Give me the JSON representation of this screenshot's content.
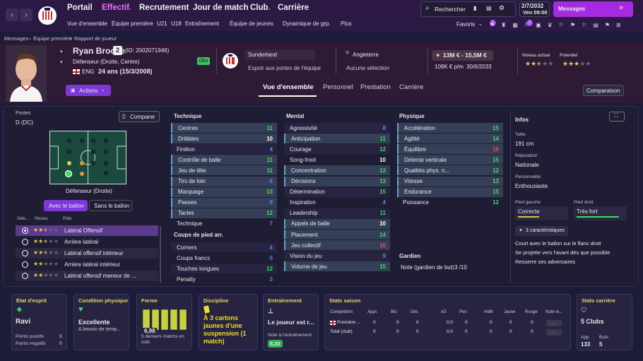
{
  "nav": {
    "items": [
      "Portail",
      "Effectif",
      "Recrutement",
      "Jour de match",
      "Club",
      "Carrière"
    ],
    "sub": [
      "Vue d'ensemble",
      "Équipe première",
      "U21",
      "U18",
      "Entraînement",
      "Équipe de jeunes",
      "Dynamique de grp.",
      "Plus"
    ],
    "search": "Rechercher",
    "date": "2/7/2032",
    "day": "Ven 09:00",
    "messages": "Messages",
    "favoris": "Favoris",
    "fav_badges": [
      "1",
      "2"
    ]
  },
  "breadcrumb": [
    "Messages",
    "Équipe première",
    "Rapport de joueur"
  ],
  "player": {
    "name": "Ryan Brooke",
    "number": "2",
    "id": "(ID: 2002071946)",
    "position": "Défenseur (Droite, Centre)",
    "nation": "ENG",
    "age": "24 ans (15/3/2008)",
    "tag": "Obs",
    "club": "Sunderland",
    "club_status": "Espoir aux portes de l'équipe",
    "national": "Angleterre",
    "national_status": "Aucune sélection",
    "value": "13M € - 15,5M €",
    "wage": "108K € p/m",
    "contract": "30/6/2033",
    "level_label": "Niveau actuel",
    "potential_label": "Potentiel",
    "level_stars": 2.5,
    "potential_stars": 3,
    "actions": "Actions"
  },
  "tabs": [
    "Vue d'ensemble",
    "Personnel",
    "Prestation",
    "Carrière"
  ],
  "compare_btn": "Comparaison",
  "positions": {
    "title": "Postes",
    "value": "D (DC)",
    "compare": "Comparer",
    "role_label": "Défenseur (Droite)",
    "with_ball": "Avec le ballon",
    "without_ball": "Sans le ballon",
    "cols": [
      "Séle...",
      "Niveau",
      "Rôle"
    ],
    "roles": [
      {
        "name": "Latéral Offensif",
        "stars": 2.5,
        "selected": true
      },
      {
        "name": "Arrière latéral",
        "stars": 2.5,
        "selected": false
      },
      {
        "name": "Latéral offensif intérieur",
        "stars": 2.5,
        "selected": false
      },
      {
        "name": "Arrière latéral intérieur",
        "stars": 2,
        "selected": false
      },
      {
        "name": "Latéral offensif meneur de ...",
        "stars": 2,
        "selected": false
      }
    ]
  },
  "technique": {
    "title": "Technique",
    "rows": [
      [
        "Centres",
        "11"
      ],
      [
        "Dribbles",
        "10"
      ],
      [
        "Finition",
        "4"
      ],
      [
        "Contrôle de balle",
        "11"
      ],
      [
        "Jeu de tête",
        "11"
      ],
      [
        "Tirs de loin",
        "6"
      ],
      [
        "Marquage",
        "13"
      ],
      [
        "Passes",
        "9"
      ],
      [
        "Tacles",
        "12"
      ],
      [
        "Technique",
        "7"
      ]
    ]
  },
  "setpieces": {
    "title": "Coups de pied arr.",
    "rows": [
      [
        "Corners",
        "4"
      ],
      [
        "Coups francs",
        "5"
      ],
      [
        "Touches longues",
        "12"
      ],
      [
        "Penalty",
        "3"
      ]
    ]
  },
  "mental": {
    "title": "Mental",
    "rows": [
      [
        "Agressivité",
        "8"
      ],
      [
        "Anticipation",
        "11"
      ],
      [
        "Courage",
        "12"
      ],
      [
        "Song-froid",
        "10"
      ],
      [
        "Concentration",
        "13"
      ],
      [
        "Décisions",
        "13"
      ],
      [
        "Détermination",
        "15"
      ],
      [
        "Inspiration",
        "4"
      ],
      [
        "Leadership",
        "11"
      ],
      [
        "Appels de balle",
        "10"
      ],
      [
        "Placement",
        "14"
      ],
      [
        "Jeu collectif",
        "16"
      ],
      [
        "Vision du jeu",
        "9"
      ],
      [
        "Volume de jeu",
        "15"
      ]
    ]
  },
  "physique": {
    "title": "Physique",
    "rows": [
      [
        "Accélération",
        "15"
      ],
      [
        "Agilité",
        "14"
      ],
      [
        "Équilibre",
        "16"
      ],
      [
        "Détente verticale",
        "15"
      ],
      [
        "Qualités phys. n...",
        "12"
      ],
      [
        "Vitesse",
        "13"
      ],
      [
        "Endurance",
        "15"
      ],
      [
        "Puissance",
        "12"
      ]
    ]
  },
  "gardien": {
    "title": "Gardien",
    "label": "Note (gardien de but)",
    "value": "3 /10"
  },
  "infos": {
    "title": "Infos",
    "height_label": "Taille",
    "height": "191 cm",
    "rep_label": "Réputation",
    "rep": "Nationale",
    "pers_label": "Personnalité",
    "pers": "Enthousiaste",
    "lfoot_label": "Pied gauche",
    "lfoot": "Correcte",
    "rfoot_label": "Pied droit",
    "rfoot": "Très fort",
    "lfoot_level": 0.45,
    "rfoot_level": 0.9,
    "traits_btn": "3 caractéristiques",
    "traits": [
      "Court avec le ballon sur le flanc droit",
      "Se projette vers l'avant dès que possible",
      "Resserre ses adversaires"
    ]
  },
  "cards": {
    "morale": {
      "title": "État d'esprit",
      "value": "Ravi",
      "pos_label": "Points positifs",
      "pos": "3",
      "neg_label": "Points négatifs",
      "neg": "0"
    },
    "condition": {
      "title": "Condition physique",
      "value": "Excellente",
      "sub": "A besoin de temp..."
    },
    "form": {
      "title": "Forme",
      "value": "6,98",
      "sub": "5 derniers matchs en club"
    },
    "discipline": {
      "title": "Discipline",
      "text": "À 3 cartons jaunes d'une suspension (1 match)"
    },
    "training": {
      "title": "Entraînement",
      "text": "Le joueur est r...",
      "sub": "Note à l'entraînement",
      "value": "8,20"
    },
    "season": {
      "title": "Stats saison",
      "cols": [
        "Compétition",
        "Apps",
        "Bts",
        "Déc",
        "xG",
        "Pen",
        "HdM",
        "Jaune",
        "Rouge",
        "Note m..."
      ],
      "rows": [
        [
          "Première ...",
          "0",
          "0",
          "0",
          "0,0",
          "0",
          "0",
          "0",
          "0",
          "-"
        ],
        [
          "Total (club)",
          "0",
          "0",
          "0",
          "0,0",
          "0",
          "0",
          "0",
          "0",
          "-"
        ]
      ]
    },
    "career": {
      "title": "Stats carrière",
      "value": "5 Clubs",
      "app_label": "App",
      "app": "133",
      "goals_label": "Buts",
      "goals": "5"
    }
  },
  "colors": {
    "accent": "#c06bff",
    "nav_active": "#f36bff",
    "good": "#3ddc60",
    "mid": "#e8e8f0",
    "low": "#6a7cff",
    "bad": "#ff4050"
  }
}
